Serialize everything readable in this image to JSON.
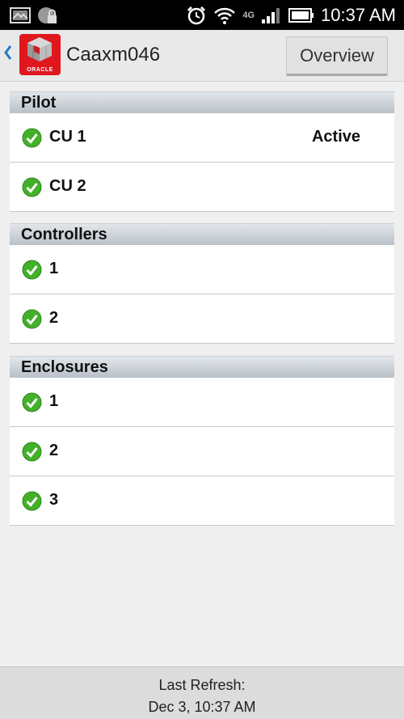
{
  "status_bar": {
    "time": "10:37 AM",
    "network": "4G",
    "icons": [
      "image-notification-icon",
      "lock-notification-icon",
      "alarm-icon",
      "wifi-icon",
      "signal-icon",
      "battery-icon"
    ]
  },
  "action_bar": {
    "title": "Caaxm046",
    "logo_text": "ORACLE",
    "overview_label": "Overview",
    "accent_color": "#e0181e"
  },
  "sections": {
    "pilot": {
      "title": "Pilot",
      "rows": [
        {
          "label": "CU 1",
          "status": "Active"
        },
        {
          "label": "CU 2",
          "status": ""
        }
      ]
    },
    "controllers": {
      "title": "Controllers",
      "rows": [
        {
          "label": "1"
        },
        {
          "label": "2"
        }
      ]
    },
    "enclosures": {
      "title": "Enclosures",
      "rows": [
        {
          "label": "1"
        },
        {
          "label": "2"
        },
        {
          "label": "3"
        }
      ]
    }
  },
  "footer": {
    "label": "Last Refresh:",
    "timestamp": "Dec 3, 10:37 AM"
  }
}
